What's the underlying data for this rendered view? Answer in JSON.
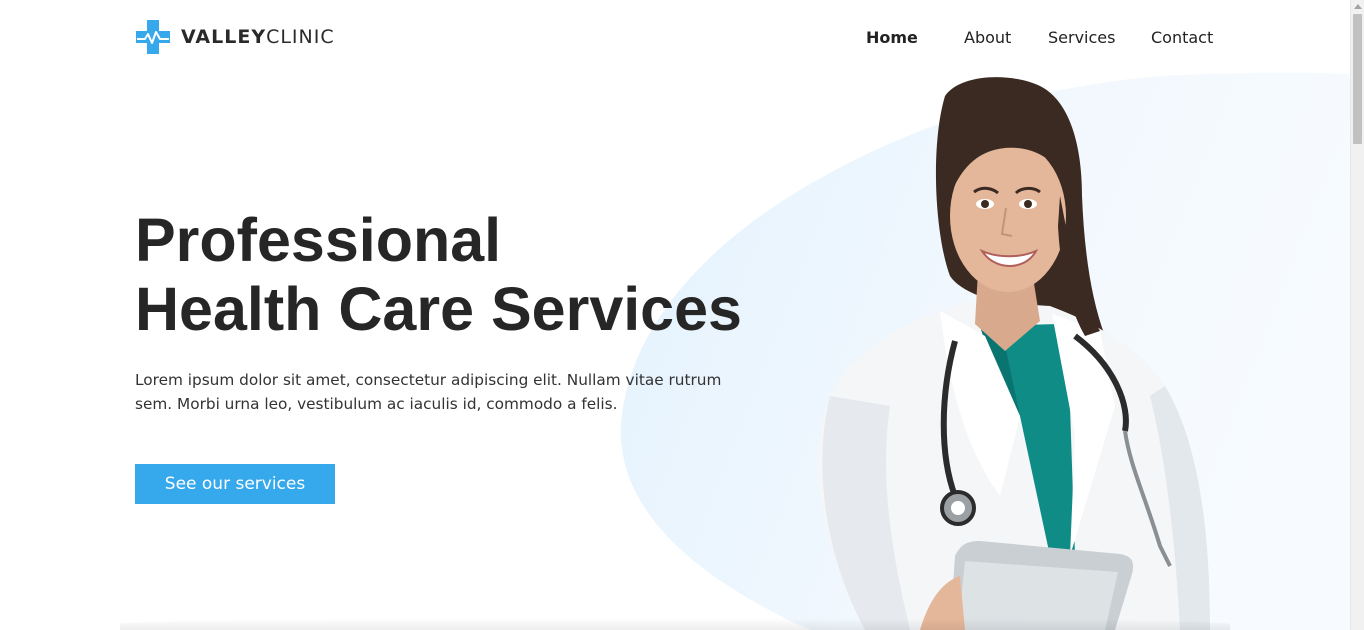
{
  "brand": {
    "name_bold": "VALLEY",
    "name_light": "CLINIC",
    "logo_icon": "medical-cross-heartbeat-icon",
    "accent_color": "#36a8ec"
  },
  "nav": {
    "items": [
      {
        "label": "Home",
        "active": true
      },
      {
        "label": "About",
        "active": false
      },
      {
        "label": "Services",
        "active": false
      },
      {
        "label": "Contact",
        "active": false
      }
    ]
  },
  "hero": {
    "headline_line1": "Professional",
    "headline_line2": "Health Care Services",
    "lead": "Lorem ipsum dolor sit amet, consectetur adipiscing elit. Nullam vitae rutrum sem. Morbi urna leo, vestibulum ac iaculis id, commodo a felis.",
    "cta_label": "See our services",
    "image_subject": "smiling female doctor in white coat with stethoscope holding a tablet"
  }
}
